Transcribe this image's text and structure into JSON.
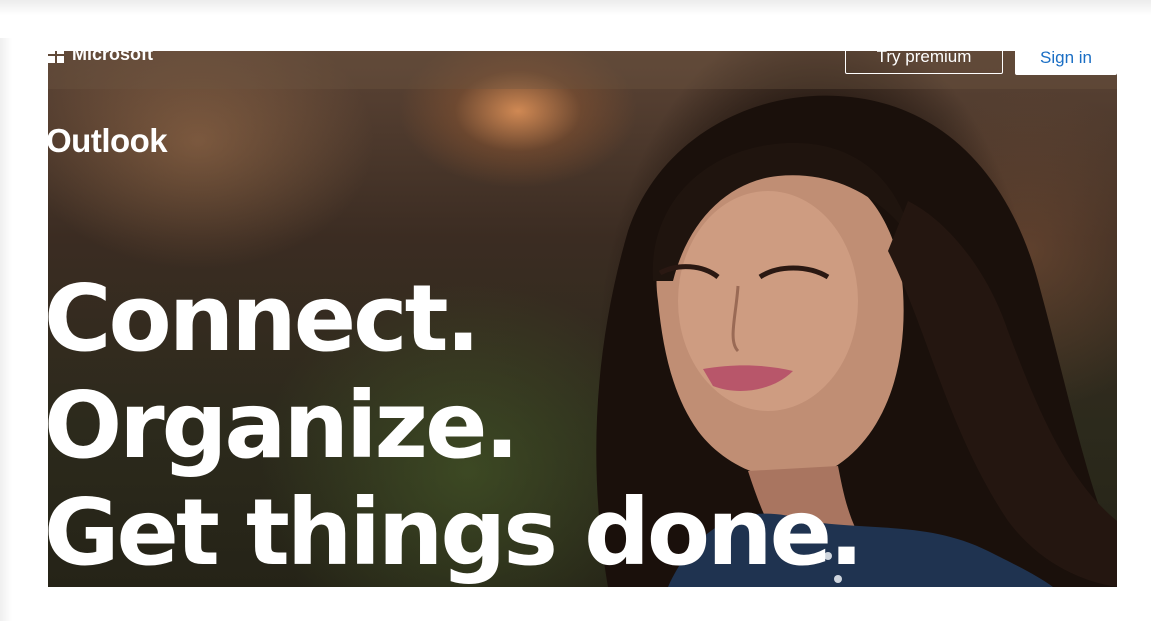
{
  "header": {
    "brand": "Microsoft",
    "try_premium_label": "Try premium",
    "sign_in_label": "Sign in"
  },
  "hero": {
    "app_name": "Outlook",
    "headline": [
      "Connect.",
      "Organize.",
      "Get things done."
    ]
  },
  "colors": {
    "sign_in_text": "#1a6ec4",
    "hero_text": "#ffffff"
  }
}
